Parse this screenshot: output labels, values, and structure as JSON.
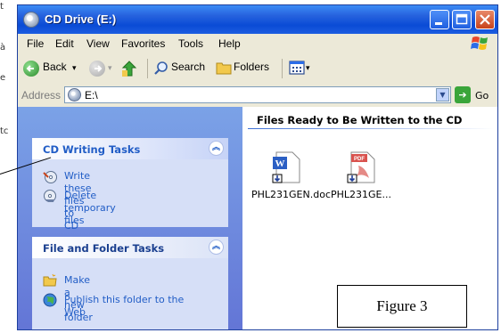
{
  "window": {
    "title": "CD Drive (E:)"
  },
  "edge_fragments": [
    "t",
    "à",
    "e",
    "tc"
  ],
  "menubar": {
    "items": [
      "File",
      "Edit",
      "View",
      "Favorites",
      "Tools",
      "Help"
    ]
  },
  "toolbar": {
    "back": "Back",
    "search": "Search",
    "folders": "Folders"
  },
  "address": {
    "label": "Address",
    "value": "E:\\",
    "go": "Go"
  },
  "left_panels": [
    {
      "title": "CD Writing Tasks",
      "tasks": [
        "Write these files to CD",
        "Delete temporary files"
      ]
    },
    {
      "title": "File and Folder Tasks",
      "tasks": [
        "Make a new folder",
        "Publish this folder to the Web"
      ]
    }
  ],
  "files": {
    "group_title": "Files Ready to Be Written to the CD",
    "items": [
      {
        "name": "PHL231GEN.doc",
        "type": "word"
      },
      {
        "name": "PHL231GE...",
        "type": "pdf"
      }
    ]
  },
  "figure_label": "Figure 3",
  "colors": {
    "title_bar": "#0a4bd6",
    "task_pane": "#6375d6",
    "panel": "#d6dff7",
    "link": "#215dc6"
  }
}
